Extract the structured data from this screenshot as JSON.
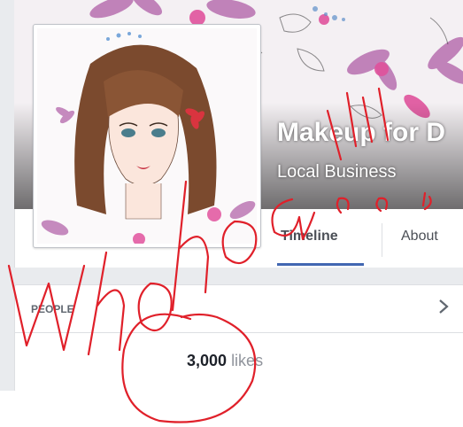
{
  "header": {
    "page_name": "Makeup for D",
    "category": "Local Business"
  },
  "tabs": [
    {
      "label": "Timeline",
      "active": true
    },
    {
      "label": "About",
      "active": false
    }
  ],
  "people_section": {
    "header": "PEOPLE",
    "likes_count": "3,000",
    "likes_label": "likes"
  },
  "annotation": {
    "ink_color": "#e0202a"
  },
  "colors": {
    "accent": "#4267b2",
    "page_background": "#e9ebee"
  }
}
